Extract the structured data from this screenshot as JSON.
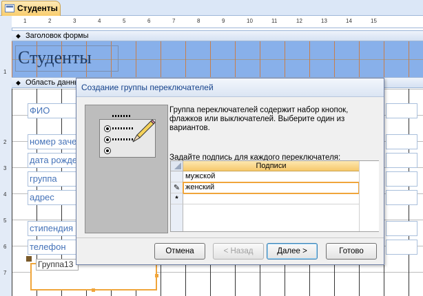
{
  "document_tab": {
    "title": "Студенты"
  },
  "ruler": {
    "h": [
      "1",
      "2",
      "3",
      "4",
      "5",
      "6",
      "7",
      "8",
      "9",
      "10",
      "11",
      "12",
      "13",
      "14",
      "15"
    ],
    "v": [
      "1",
      "2",
      "3",
      "4",
      "5",
      "6",
      "7"
    ]
  },
  "sections": {
    "header": "Заголовок формы",
    "detail": "Область данных"
  },
  "form": {
    "title": "Студенты",
    "fields": [
      "ФИО",
      "номер зачетной",
      "дата рождения",
      "группа",
      "адрес",
      "стипендия",
      "телефон"
    ],
    "group_label": "Группа13"
  },
  "dialog": {
    "title": "Создание группы переключателей",
    "description": "Группа переключателей содержит набор кнопок, флажков или выключателей. Выберите один из вариантов.",
    "prompt": "Задайте подпись для каждого переключателя:",
    "grid": {
      "column_header": "Подписи",
      "rows": [
        "мужской",
        "женский",
        ""
      ],
      "row_markers": [
        "",
        "✎",
        "*"
      ]
    },
    "buttons": {
      "cancel": "Отмена",
      "back": "< Назад",
      "next": "Далее >",
      "finish": "Готово"
    }
  },
  "icons": {
    "tab": "form-icon",
    "pencil": "pencil-icon",
    "collapse": "collapse-arrow-icon"
  }
}
